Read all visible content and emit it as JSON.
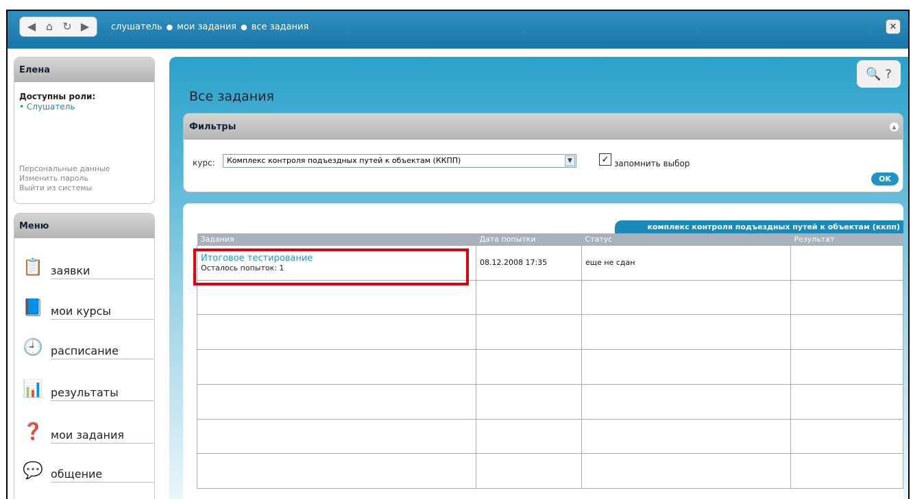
{
  "topbar": {
    "nav": {
      "back_icon": "back-arrow-icon",
      "home_icon": "home-icon",
      "refresh_icon": "refresh-icon",
      "forward_icon": "forward-arrow-icon"
    },
    "breadcrumb": [
      "слушатель",
      "мои задания",
      "все задания"
    ],
    "close_icon": "close-icon"
  },
  "sidebar": {
    "user_name": "Елена",
    "roles_title": "Доступны роли:",
    "roles": [
      "Слушатель"
    ],
    "links": [
      "Персональные данные",
      "Изменить пароль",
      "Выйти из системы"
    ],
    "menu_title": "Меню",
    "menu": [
      {
        "label": "заявки",
        "icon": "requests-icon"
      },
      {
        "label": "мои курсы",
        "icon": "courses-icon"
      },
      {
        "label": "расписание",
        "icon": "schedule-icon"
      },
      {
        "label": "результаты",
        "icon": "results-icon"
      },
      {
        "label": "мои задания",
        "icon": "tasks-icon"
      },
      {
        "label": "общение",
        "icon": "chat-icon"
      }
    ]
  },
  "main": {
    "title": "Все задания",
    "tools": [
      "preview-icon",
      "help-icon"
    ],
    "filters": {
      "title": "Фильтры",
      "course_label": "курс:",
      "course_value": "Комплекс контроля подъездных путей к объектам (ККПП)",
      "remember_label": "запомнить выбор",
      "remember_checked": true,
      "ok_label": "OK"
    },
    "results": {
      "course_tab": "комплекс контроля подъездных путей к объектам (ккпп)",
      "columns": [
        "Задания",
        "Дата попытки",
        "Статус",
        "Результат"
      ],
      "rows": [
        {
          "task": "Итоговое тестирование",
          "attempts": "Осталось попыток: 1",
          "date": "08.12.2008 17:35",
          "status": "еще не сдан",
          "result": ""
        }
      ]
    }
  },
  "colors": {
    "accent": "#1a8ab8",
    "highlight": "#e1000f",
    "header_gray": "#a8b2bc"
  }
}
